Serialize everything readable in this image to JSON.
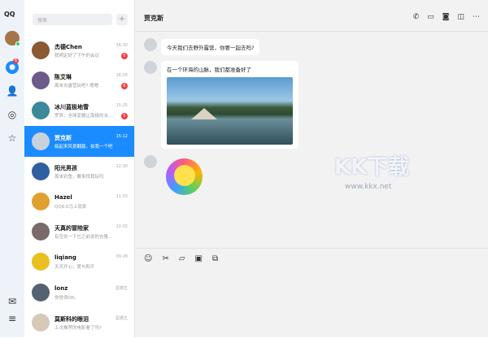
{
  "app": {
    "logo": "QQ"
  },
  "rail": {
    "badge": "6",
    "icons": [
      "chat-icon",
      "contacts-icon",
      "discover-icon",
      "favorites-icon",
      "mail-icon",
      "menu-icon"
    ]
  },
  "search": {
    "placeholder": "搜索",
    "add": "+"
  },
  "conversations": [
    {
      "name": "杰德Chen",
      "msg": "我明定好了下午的会议",
      "time": "16:30",
      "badge": "6",
      "color": "#8a5a35"
    },
    {
      "name": "陈艾琳",
      "msg": "周末去露营玩吧? 嗯嗯",
      "time": "16:05",
      "badge": "6",
      "color": "#6b5a8a"
    },
    {
      "name": "冰川蓝极地雪",
      "msg": "罗宾：全球变暖让南极的冰...",
      "time": "15:25",
      "badge": "5",
      "color": "#3a8a9a"
    },
    {
      "name": "贾克斯",
      "msg": "临起来风景翻篇，拍我一个吧",
      "time": "15:12",
      "badge": "",
      "color": "#c8d2dc"
    },
    {
      "name": "阳光男孩",
      "msg": "周末钓鱼，要来找我玩吗",
      "time": "12:30",
      "badge": "",
      "color": "#2f5fa0"
    },
    {
      "name": "Hazel",
      "msg": "QQ9.0马上就来",
      "time": "11:03",
      "badge": "",
      "color": "#e0a030"
    },
    {
      "name": "天真的冒险家",
      "msg": "有空去一下它之前说的吉隆...",
      "time": "10:02",
      "badge": "",
      "color": "#7a6a6a"
    },
    {
      "name": "liqiang",
      "msg": "天天开心，爱与和平",
      "time": "09:28",
      "badge": "",
      "color": "#e8c020"
    },
    {
      "name": "lonz",
      "msg": "你觉得OK。",
      "time": "星期五",
      "badge": "",
      "color": "#556070"
    },
    {
      "name": "莫斯科的眼泪",
      "msg": "上次推荐的电影看了吗?",
      "time": "星期五",
      "badge": "",
      "color": "#d8c8b8"
    }
  ],
  "chat": {
    "title": "贾克斯",
    "header_icons": [
      "phone-icon",
      "video-icon",
      "screen-share-icon",
      "window-icon",
      "more-icon"
    ],
    "messages": [
      {
        "text": "今天我们去野外露营，你要一起去吗?"
      },
      {
        "text": "在一个环海的山脉，我们都准备好了"
      }
    ],
    "toolbar": [
      "emoji-icon",
      "scissors-icon",
      "folder-icon",
      "image-icon",
      "screen-record-icon"
    ]
  },
  "watermark": {
    "text": "KK下载",
    "url": "www.kkx.net"
  }
}
